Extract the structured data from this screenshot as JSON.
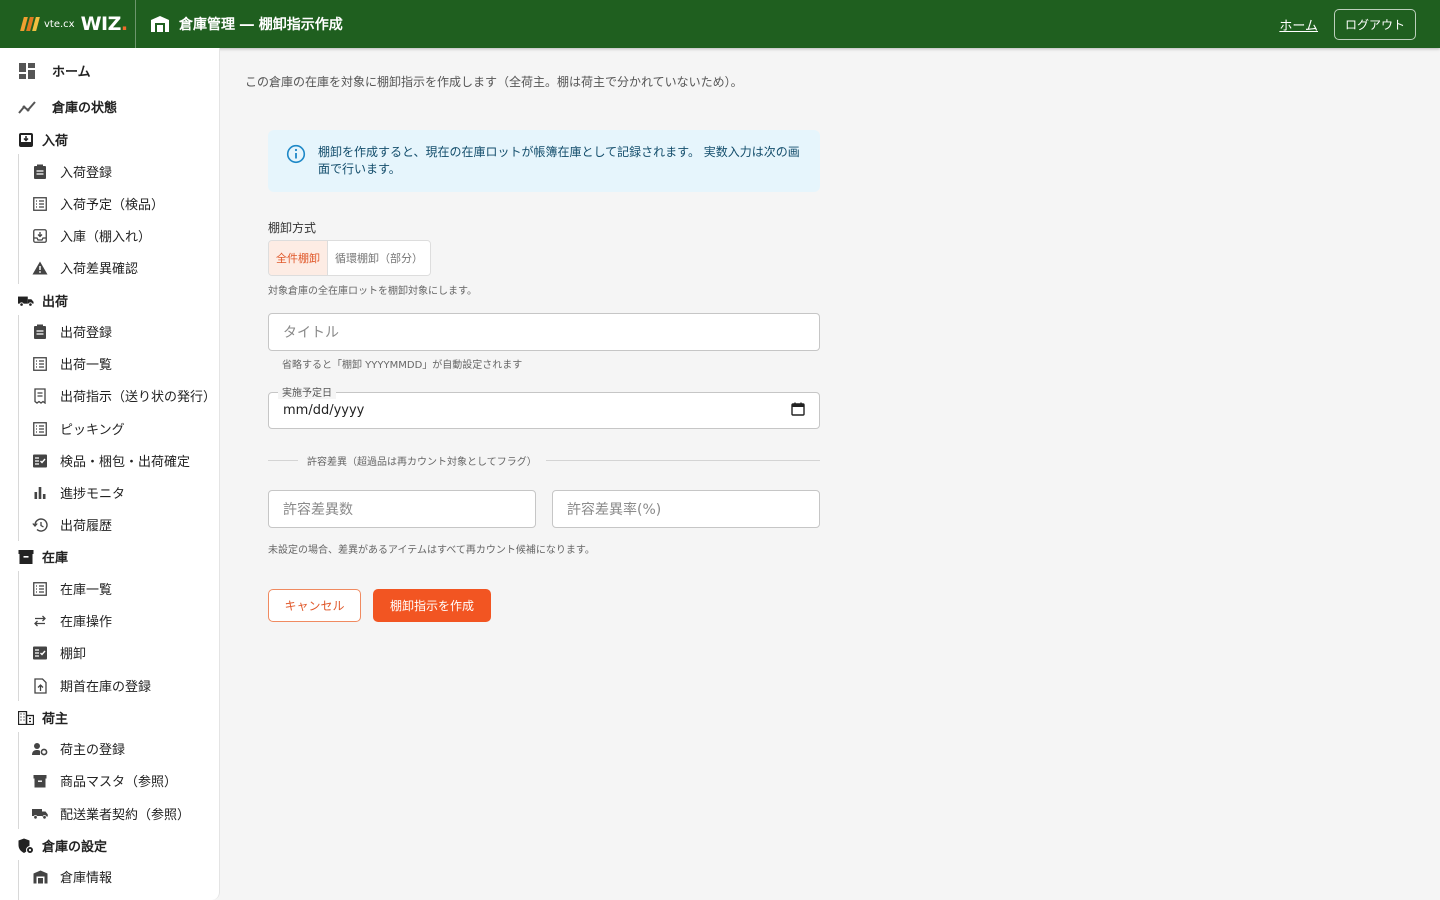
{
  "header": {
    "logo_small": "vte.cx",
    "logo_big": "WIZ",
    "logo_dot": ".",
    "title": "倉庫管理 ― 棚卸指示作成",
    "home_link": "ホーム",
    "logout_button": "ログアウト"
  },
  "sidebar": {
    "top_items": [
      {
        "label": "ホーム",
        "icon": "dashboard-icon"
      },
      {
        "label": "倉庫の状態",
        "icon": "trend-icon"
      }
    ],
    "sections": [
      {
        "label": "入荷",
        "icon": "move-to-inbox-icon",
        "items": [
          {
            "label": "入荷登録",
            "icon": "clipboard-icon"
          },
          {
            "label": "入荷予定（検品）",
            "icon": "list-icon"
          },
          {
            "label": "入庫（棚入れ）",
            "icon": "move-to-inbox-icon"
          },
          {
            "label": "入荷差異確認",
            "icon": "warning-icon"
          }
        ]
      },
      {
        "label": "出荷",
        "icon": "truck-icon",
        "items": [
          {
            "label": "出荷登録",
            "icon": "clipboard-icon"
          },
          {
            "label": "出荷一覧",
            "icon": "list-icon"
          },
          {
            "label": "出荷指示（送り状の発行）",
            "icon": "receipt-icon"
          },
          {
            "label": "ピッキング",
            "icon": "list-icon"
          },
          {
            "label": "検品・梱包・出荷確定",
            "icon": "fact-check-icon"
          },
          {
            "label": "進捗モニタ",
            "icon": "bar-chart-icon"
          },
          {
            "label": "出荷履歴",
            "icon": "history-icon"
          }
        ]
      },
      {
        "label": "在庫",
        "icon": "archive-icon",
        "items": [
          {
            "label": "在庫一覧",
            "icon": "list-icon"
          },
          {
            "label": "在庫操作",
            "icon": "swap-icon"
          },
          {
            "label": "棚卸",
            "icon": "fact-check-icon"
          },
          {
            "label": "期首在庫の登録",
            "icon": "upload-file-icon"
          }
        ]
      },
      {
        "label": "荷主",
        "icon": "business-icon",
        "items": [
          {
            "label": "荷主の登録",
            "icon": "manage-accounts-icon"
          },
          {
            "label": "商品マスタ（参照）",
            "icon": "archive-icon"
          },
          {
            "label": "配送業者契約（参照）",
            "icon": "truck-icon"
          }
        ]
      },
      {
        "label": "倉庫の設定",
        "icon": "warehouse-settings-icon",
        "items": [
          {
            "label": "倉庫情報",
            "icon": "warehouse-icon"
          }
        ]
      }
    ]
  },
  "main": {
    "description": "この倉庫の在庫を対象に棚卸指示を作成します（全荷主。棚は荷主で分かれていないため）。",
    "info_text": "棚卸を作成すると、現在の在庫ロットが帳簿在庫として記録されます。 実数入力は次の画面で行います。",
    "method_label": "棚卸方式",
    "method_options": [
      "全件棚卸",
      "循環棚卸（部分）"
    ],
    "method_selected": "全件棚卸",
    "method_help": "対象倉庫の全在庫ロットを棚卸対象にします。",
    "title_placeholder": "タイトル",
    "title_value": "",
    "title_help": "省略すると「棚卸 YYYYMMDD」が自動設定されます",
    "date_label": "実施予定日",
    "date_value": "mm/dd/yyyy",
    "tolerance_divider": "許容差異（超過品は再カウント対象としてフラグ）",
    "tolerance_count_placeholder": "許容差異数",
    "tolerance_rate_placeholder": "許容差異率(%)",
    "tolerance_help": "未設定の場合、差異があるアイテムはすべて再カウント候補になります。",
    "cancel_button": "キャンセル",
    "create_button": "棚卸指示を作成"
  },
  "colors": {
    "header_bg": "#1f5f1f",
    "accent": "#f25522",
    "info_bg": "#e6f5fc",
    "info_text": "#134d6b"
  }
}
